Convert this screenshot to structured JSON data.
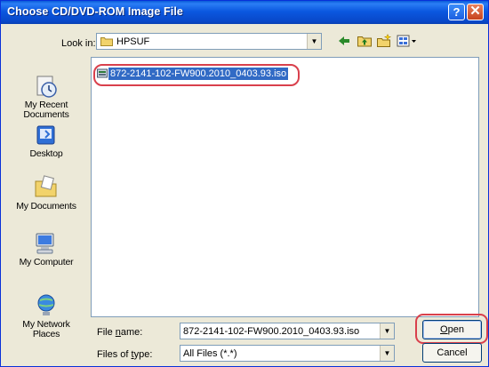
{
  "window": {
    "title": "Choose CD/DVD-ROM Image File",
    "help_label": "?",
    "close_label": "✕"
  },
  "lookin": {
    "label": "Look in:",
    "value": "HPSUF"
  },
  "toolbar": {
    "back_icon": "back-arrow-icon",
    "up_icon": "up-one-level-icon",
    "new_folder_icon": "new-folder-icon",
    "views_icon": "views-menu-icon"
  },
  "places": [
    {
      "label_1": "My Recent",
      "label_2": "Documents",
      "icon": "my-recent-documents-icon"
    },
    {
      "label_1": "Desktop",
      "label_2": "",
      "icon": "desktop-icon"
    },
    {
      "label_1": "My Documents",
      "label_2": "",
      "icon": "my-documents-icon"
    },
    {
      "label_1": "My Computer",
      "label_2": "",
      "icon": "my-computer-icon"
    },
    {
      "label_1": "My Network",
      "label_2": "Places",
      "icon": "my-network-places-icon"
    }
  ],
  "files": [
    {
      "name": "872-2141-102-FW900.2010_0403.93.iso",
      "selected": true
    }
  ],
  "file_name": {
    "label_pre": "File ",
    "label_acc": "n",
    "label_post": "ame:",
    "value": "872-2141-102-FW900.2010_0403.93.iso"
  },
  "file_type": {
    "label_pre": "Files of ",
    "label_acc": "t",
    "label_post": "ype:",
    "value": "All Files (*.*)"
  },
  "buttons": {
    "open_acc": "O",
    "open_rest": "pen",
    "cancel": "Cancel"
  },
  "colors": {
    "titlebar": "#0b58e0",
    "selection": "#316ac5",
    "highlight": "#d9404c"
  }
}
